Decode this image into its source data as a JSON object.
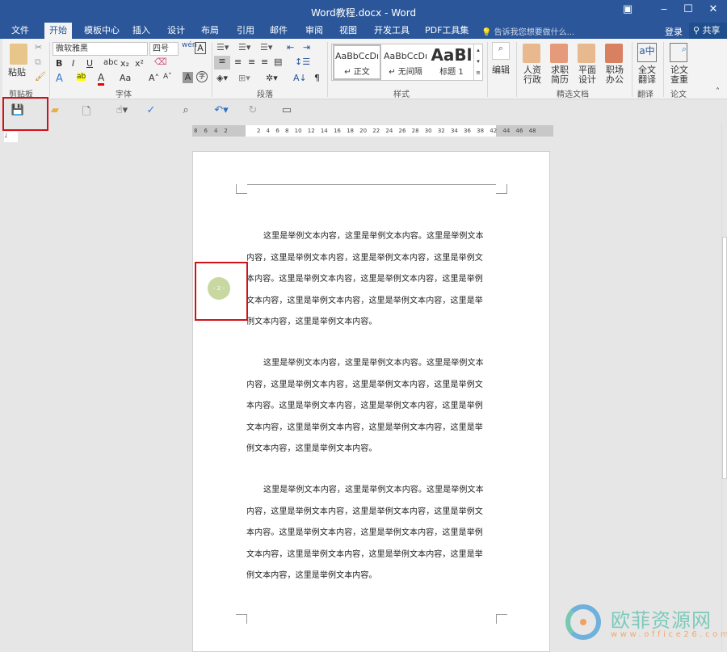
{
  "window": {
    "title": "Word教程.docx - Word",
    "controls": [
      "restore-ribbon",
      "minimize",
      "maximize",
      "close"
    ]
  },
  "tabs": [
    "文件",
    "开始",
    "模板中心",
    "插入",
    "设计",
    "布局",
    "引用",
    "邮件",
    "审阅",
    "视图",
    "开发工具",
    "PDF工具集"
  ],
  "active_tab": "开始",
  "tell_me": "告诉我您想要做什么...",
  "account": {
    "login": "登录",
    "share": "共享"
  },
  "ribbon": {
    "clipboard": {
      "paste": "粘贴",
      "label": "剪贴板"
    },
    "font": {
      "name": "微软雅黑",
      "size": "四号",
      "label": "字体",
      "bold": "B",
      "italic": "I",
      "underline": "U",
      "strike": "abc",
      "sub": "x₂",
      "sup": "x²",
      "case": "Aa"
    },
    "paragraph": {
      "label": "段落"
    },
    "styles": {
      "label": "样式",
      "items": [
        {
          "preview": "AaBbCcDı",
          "name": "↵ 正文"
        },
        {
          "preview": "AaBbCcDı",
          "name": "↵ 无间隔"
        },
        {
          "preview": "AaBl",
          "name": "标题 1"
        }
      ]
    },
    "edit": {
      "label": "编辑"
    },
    "featured": {
      "label": "精选文档",
      "items": [
        "人资\n行政",
        "求职\n简历",
        "平面\n设计",
        "职场\n办公"
      ]
    },
    "translate": {
      "button": "全文\n翻译",
      "label": "翻译"
    },
    "paper": {
      "button": "论文\n查重",
      "label": "论文"
    }
  },
  "ruler": {
    "left": [
      "8",
      "6",
      "4",
      "2"
    ],
    "right": [
      "2",
      "4",
      "6",
      "8",
      "10",
      "12",
      "14",
      "16",
      "18",
      "20",
      "22",
      "24",
      "26",
      "28",
      "30",
      "32",
      "34",
      "36",
      "38",
      "42",
      "44",
      "46",
      "48"
    ]
  },
  "document": {
    "paragraphs": [
      [
        "这里是举例文本内容，这里是举例文本内容。这里是举例文本",
        "内容，这里是举例文本内容，这里是举例文本内容，这里是举例文",
        "本内容。这里是举例文本内容，这里是举例文本内容，这里是举例",
        "文本内容，这里是举例文本内容，这里是举例文本内容，这里是举",
        "例文本内容，这里是举例文本内容。"
      ],
      [
        "这里是举例文本内容，这里是举例文本内容。这里是举例文本",
        "内容，这里是举例文本内容，这里是举例文本内容，这里是举例文",
        "本内容。这里是举例文本内容，这里是举例文本内容，这里是举例",
        "文本内容，这里是举例文本内容，这里是举例文本内容，这里是举",
        "例文本内容，这里是举例文本内容。"
      ],
      [
        "这里是举例文本内容，这里是举例文本内容。这里是举例文本",
        "内容，这里是举例文本内容，这里是举例文本内容，这里是举例文",
        "本内容。这里是举例文本内容，这里是举例文本内容，这里是举例",
        "文本内容，这里是举例文本内容，这里是举例文本内容，这里是举",
        "例文本内容，这里是举例文本内容。"
      ]
    ],
    "cursor_marker": "- 2 -"
  },
  "watermark": {
    "name": "欧菲资源网",
    "url": "www.office26.com"
  },
  "colors": {
    "title_bar": "#2b579a",
    "highlight_box": "#d0121b"
  }
}
